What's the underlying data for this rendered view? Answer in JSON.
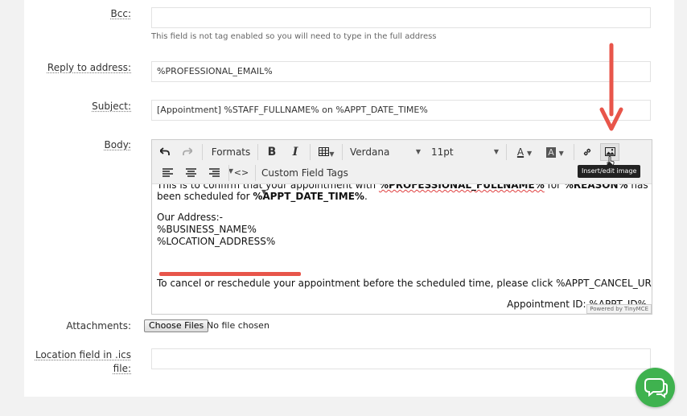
{
  "form": {
    "bcc_label": "Bcc:",
    "bcc_value": "",
    "bcc_help": "This field is not tag enabled so you will need to type in the full address",
    "reply_label": "Reply to address:",
    "reply_value": "%PROFESSIONAL_EMAIL%",
    "subject_label": "Subject:",
    "subject_value": "[Appointment] %STAFF_FULLNAME% on %APPT_DATE_TIME%",
    "body_label": "Body:",
    "attachments_label": "Attachments:",
    "choose_files_label": "Choose Files",
    "no_file_text": "No file chosen",
    "location_label_1": "Location field in .ics",
    "location_label_2": "file:",
    "location_value": ""
  },
  "toolbar": {
    "formats_label": "Formats",
    "bold_label": "B",
    "italic_label": "I",
    "font_family": "Verdana",
    "font_size": "11pt",
    "text_color_label": "A",
    "bg_color_label": "A",
    "custom_tags_label": "Custom Field Tags",
    "code_label": "<>",
    "tooltip": "Insert/edit image"
  },
  "body": {
    "l1_pre": "This is to confirm that your appointment with ",
    "l1_tag": "%PROFESSIONAL_FULLNAME%",
    "l1_mid": " for ",
    "l1_tag2": "%REASON%",
    "l1_post": " has",
    "l2_pre": "been scheduled for ",
    "l2_tag": "%APPT_DATE_TIME%",
    "l2_post": ".",
    "l3": "Our Address:-",
    "l4": "%BUSINESS_NAME%",
    "l5": "%LOCATION_ADDRESS%",
    "l6": "To cancel or reschedule your appointment before the scheduled time, please click %APPT_CANCEL_URL%",
    "l7": "Appointment ID: %APPT_ID%",
    "powered": "Powered by TinyMCE"
  },
  "colors": {
    "annotation_red": "#e8554a",
    "chat_green": "#3fb24f"
  },
  "icons": [
    "undo-icon",
    "redo-icon",
    "table-icon",
    "align-left-icon",
    "align-center-icon",
    "align-right-icon",
    "link-icon",
    "image-icon",
    "chat-icon",
    "arrow-annotation"
  ]
}
